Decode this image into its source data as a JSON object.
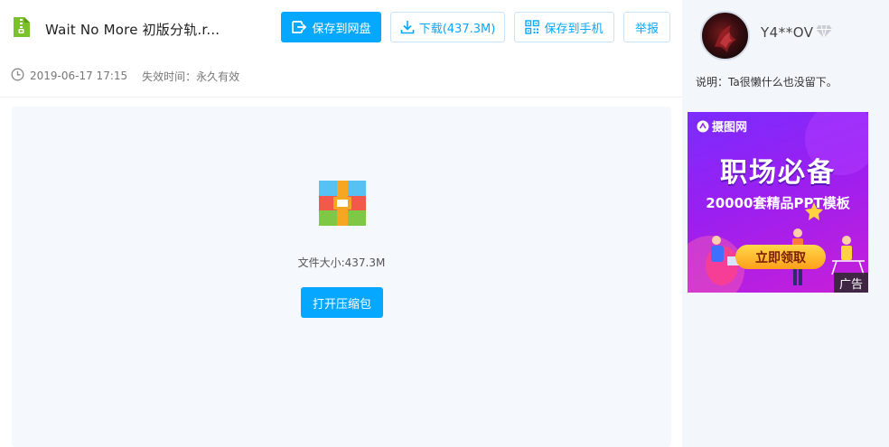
{
  "file": {
    "name": "Wait No More 初版分轨.r...",
    "date": "2019-06-17 17:15",
    "expire_label": "失效时间：永久有效",
    "size_label": "文件大小:437.3M"
  },
  "toolbar": {
    "save_to_disk": "保存到网盘",
    "download": "下载(437.3M)",
    "save_to_phone": "保存到手机",
    "report": "举报"
  },
  "preview": {
    "open_label": "打开压缩包"
  },
  "uploader": {
    "name": "Y4**OV",
    "description": "说明：Ta很懒什么也没留下。"
  },
  "ad": {
    "brand": "摄图网",
    "headline": "职场必备",
    "subline": "20000套精品PPT模板",
    "cta": "立即领取",
    "badge": "广告"
  },
  "colors": {
    "accent": "#06a7ff",
    "sidebar_bg": "#f3f6fb",
    "preview_bg": "#f5f8fc"
  },
  "icons": [
    "zip-file-icon",
    "save-disk-icon",
    "download-icon",
    "qr-code-icon",
    "clock-icon",
    "archive-icon",
    "diamond-icon"
  ]
}
